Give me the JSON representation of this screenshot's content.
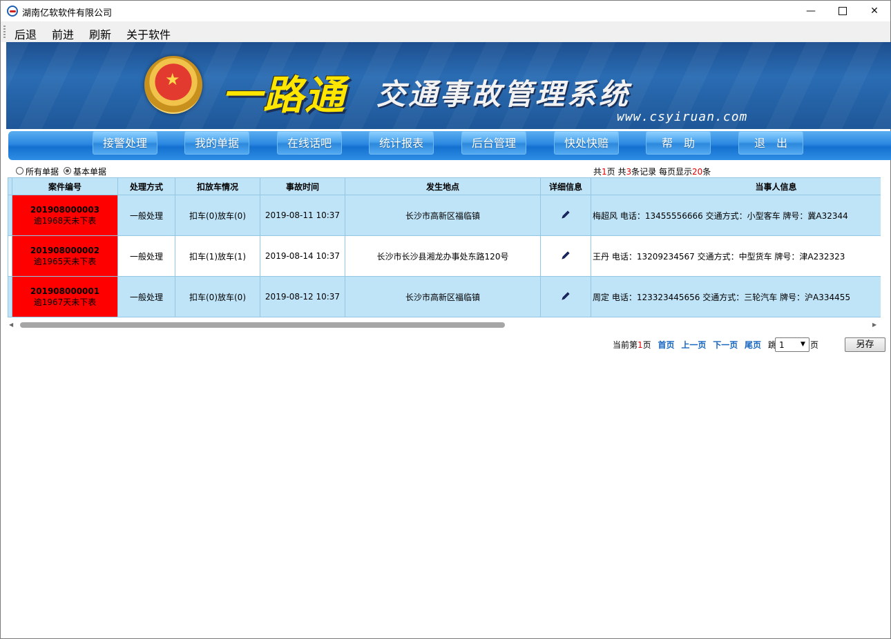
{
  "window": {
    "title": "湖南亿软软件有限公司"
  },
  "menu": [
    "后退",
    "前进",
    "刷新",
    "关于软件"
  ],
  "banner": {
    "title": "一路通",
    "subtitle": "交通事故管理系统",
    "url": "www.csyiruan.com"
  },
  "nav": [
    "接警处理",
    "我的单据",
    "在线话吧",
    "统计报表",
    "后台管理",
    "快处快赔",
    "帮　助",
    "退　出"
  ],
  "filter": {
    "option_all": "所有单据",
    "option_basic": "基本单据",
    "selected": "基本单据"
  },
  "page_info": {
    "prefix": "共",
    "total_pages": "1",
    "mid": "页  共",
    "total_records": "3",
    "mid2": "条记录  每页显示",
    "per_page": "20",
    "suffix": "条"
  },
  "table": {
    "headers": [
      "案件编号",
      "处理方式",
      "扣放车情况",
      "事故时间",
      "发生地点",
      "详细信息",
      "当事人信息"
    ],
    "rows": [
      {
        "case_no": "201908000003",
        "warn": "逾1968天未下表",
        "method": "一般处理",
        "vehicle": "扣车(0)放车(0)",
        "time": "2019-08-11 10:37",
        "location": "长沙市高新区福临镇",
        "party": "梅超风 电话：13455556666 交通方式：小型客车 牌号：冀A32344"
      },
      {
        "case_no": "201908000002",
        "warn": "逾1965天未下表",
        "method": "一般处理",
        "vehicle": "扣车(1)放车(1)",
        "time": "2019-08-14 10:37",
        "location": "长沙市长沙县湘龙办事处东路120号",
        "party": "王丹 电话：13209234567 交通方式：中型货车 牌号：津A232323"
      },
      {
        "case_no": "201908000001",
        "warn": "逾1967天未下表",
        "method": "一般处理",
        "vehicle": "扣车(0)放车(0)",
        "time": "2019-08-12 10:37",
        "location": "长沙市高新区福临镇",
        "party": "周定 电话：123323445656 交通方式：三轮汽车 牌号：沪A334455"
      }
    ]
  },
  "pager": {
    "current_prefix": "当前第",
    "current": "1",
    "current_suffix": "页",
    "first": "首页",
    "prev": "上一页",
    "next": "下一页",
    "last": "尾页",
    "jump": "跳到",
    "jump_value": "1",
    "page_unit": "页"
  },
  "save_as": "另存",
  "colors": {
    "case_bg": "#ff0000",
    "row_alt": "#bfe3f7",
    "nav_blue": "#2a86e0"
  }
}
